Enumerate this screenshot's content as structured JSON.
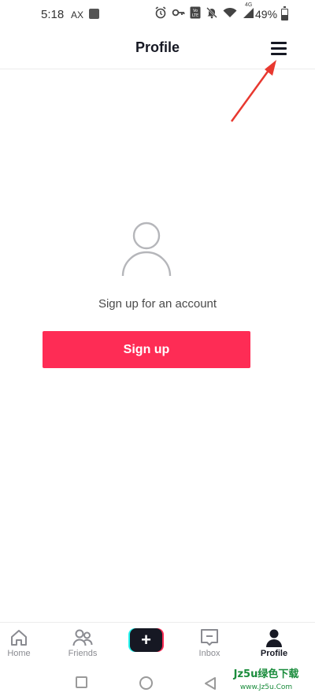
{
  "status_bar": {
    "time": "5:18",
    "carrier_tag": "AX",
    "network_tag": "4G",
    "battery_text": "49%",
    "icons": [
      "image-icon",
      "alarm-icon",
      "key-icon",
      "volte-icon",
      "mute-icon",
      "wifi-icon",
      "signal-icon",
      "battery-icon"
    ]
  },
  "header": {
    "title": "Profile",
    "menu_icon": "hamburger-menu-icon"
  },
  "annotation": {
    "arrow_color": "#e8382f"
  },
  "main": {
    "avatar_icon": "user-avatar-icon",
    "prompt": "Sign up for an account",
    "signup_button": "Sign up"
  },
  "bottom_nav": {
    "items": [
      {
        "label": "Home",
        "icon": "home-icon",
        "active": false
      },
      {
        "label": "Friends",
        "icon": "friends-icon",
        "active": false
      },
      {
        "label": "",
        "icon": "plus-icon",
        "active": false
      },
      {
        "label": "Inbox",
        "icon": "inbox-icon",
        "active": false
      },
      {
        "label": "Profile",
        "icon": "profile-icon",
        "active": true
      }
    ]
  },
  "system_nav": {
    "buttons": [
      "recents-button",
      "home-button",
      "back-button"
    ]
  },
  "watermark": {
    "line1": "Jz5u绿色下载",
    "line2": "www.Jz5u.Com"
  },
  "colors": {
    "accent": "#fe2c55",
    "cyan": "#25f4ee",
    "dark": "#161823",
    "gray": "#8a8b91"
  }
}
